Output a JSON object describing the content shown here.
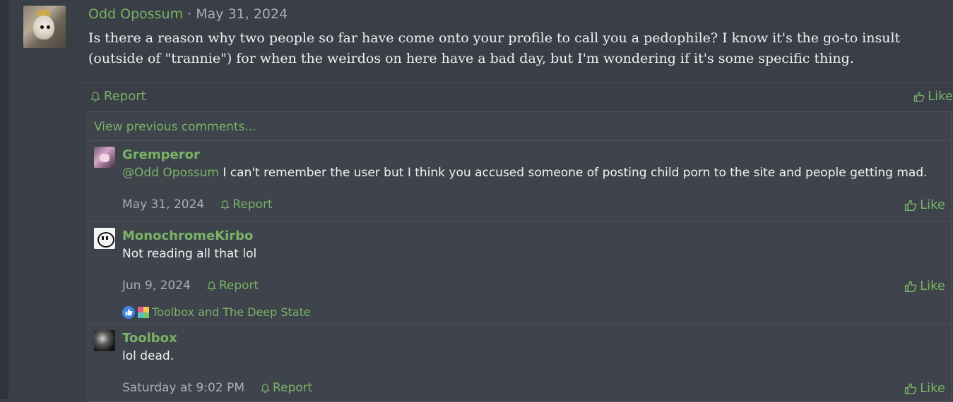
{
  "post": {
    "author": "Odd Opossum",
    "separator": "·",
    "date": "May 31, 2024",
    "body": "Is there a reason why two people so far have come onto your profile to call you a pedophile? I know it's the go-to insult (outside of \"trannie\") for when the weirdos on here have a bad day, but I'm wondering if it's some specific thing.",
    "report_label": "Report",
    "like_label": "Like"
  },
  "comments": {
    "view_previous": "View previous comments...",
    "items": [
      {
        "author": "Gremperor",
        "mention": "@Odd Opossum",
        "text": " I can't remember the user but I think you accused someone of posting child porn to the site and people getting mad.",
        "date": "May 31, 2024",
        "report_label": "Report",
        "like_label": "Like"
      },
      {
        "author": "MonochromeKirbo",
        "text": "Not reading all that lol",
        "date": "Jun 9, 2024",
        "report_label": "Report",
        "like_label": "Like",
        "reactions": "Toolbox and The Deep State"
      },
      {
        "author": "Toolbox",
        "text": "lol dead.",
        "date": "Saturday at 9:02 PM",
        "report_label": "Report",
        "like_label": "Like"
      }
    ]
  },
  "colors": {
    "accent": "#78b366",
    "background": "#3a3e46",
    "muted": "#a9adb5"
  },
  "icons": [
    "bell-icon",
    "thumbs-up-icon",
    "like-reaction-icon",
    "puzzle-reaction-icon"
  ]
}
